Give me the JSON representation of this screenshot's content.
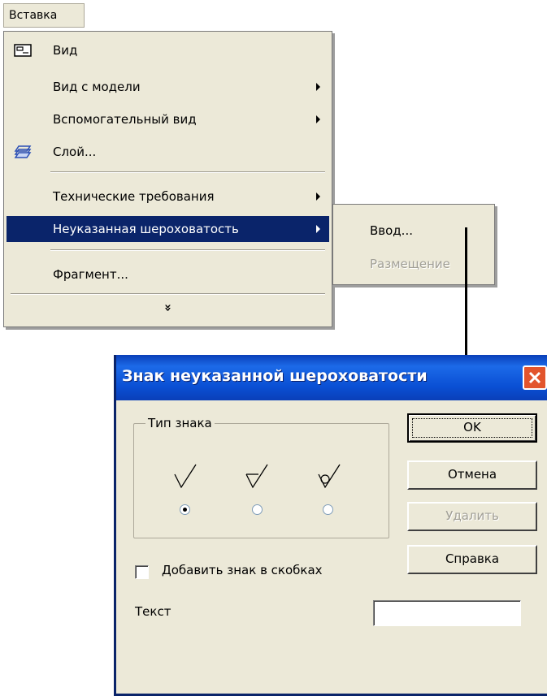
{
  "menubar": {
    "insert_label": "Вставка"
  },
  "menu": {
    "items": [
      {
        "label": "Вид",
        "icon": "view-icon",
        "submenu": false
      },
      {
        "label": "Вид с модели",
        "icon": "",
        "submenu": true
      },
      {
        "label": "Вспомогательный вид",
        "icon": "",
        "submenu": true
      },
      {
        "label": "Слой...",
        "icon": "layer-icon",
        "submenu": false
      },
      {
        "label": "Технические требования",
        "icon": "",
        "submenu": true
      },
      {
        "label": "Неуказанная шероховатость",
        "icon": "",
        "submenu": true,
        "selected": true
      },
      {
        "label": "Фрагмент...",
        "icon": "",
        "submenu": false
      }
    ],
    "expand_glyph": "»"
  },
  "submenu": {
    "items": [
      {
        "label": "Ввод...",
        "enabled": true
      },
      {
        "label": "Размещение",
        "enabled": false
      }
    ]
  },
  "dialog": {
    "title": "Знак неуказанной шероховатости",
    "group_title": "Тип знака",
    "sign_types": [
      "basic",
      "no-removal",
      "removal"
    ],
    "selected_sign_index": 0,
    "buttons": {
      "ok": "OK",
      "cancel": "Отмена",
      "delete": "Удалить",
      "help": "Справка"
    },
    "checkbox_label": "Добавить знак в скобках",
    "checkbox_checked": false,
    "text_label": "Текст",
    "text_value": ""
  },
  "colors": {
    "menu_bg": "#ece9d8",
    "highlight": "#0a246a",
    "titlebar": "#0a4fd4",
    "close_button": "#e2542c",
    "disabled_text": "#a19f96"
  }
}
